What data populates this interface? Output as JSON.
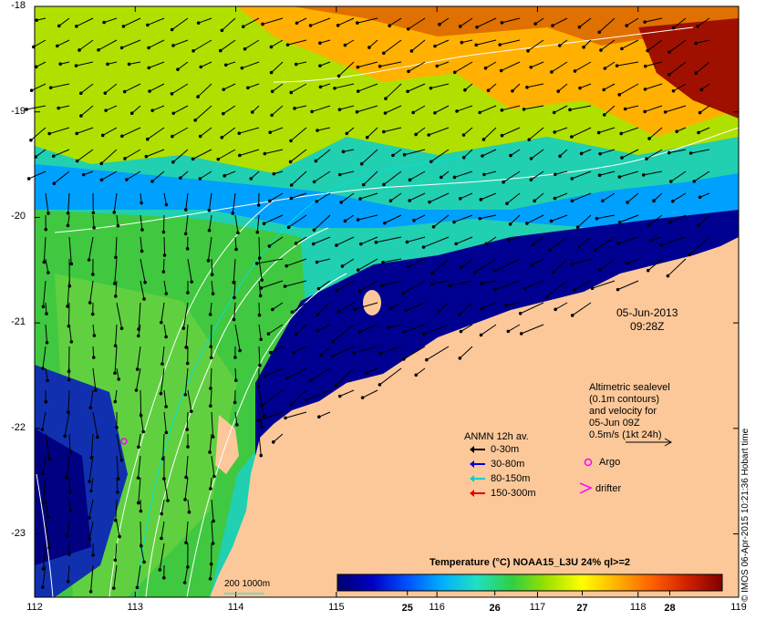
{
  "map": {
    "lat_ticks": [
      "-18",
      "-19",
      "-20",
      "-21",
      "-22",
      "-23"
    ],
    "lon_ticks": [
      "112",
      "113",
      "114",
      "115",
      "116",
      "117",
      "118",
      "119"
    ],
    "lat_range": [
      -23.6,
      -18.0
    ],
    "lon_range": [
      112.0,
      119.0
    ]
  },
  "timestamp": {
    "date": "05-Jun-2013",
    "time": "09:28Z"
  },
  "sealevel_note": {
    "lines": [
      "Altimetric sealevel",
      "(0.1m contours)",
      "and velocity for",
      "05-Jun 09Z",
      "0.5m/s (1kt 24h)"
    ]
  },
  "legend": {
    "title": "ANMN 12h av.",
    "items": [
      {
        "label": "0-30m",
        "color": "#000000"
      },
      {
        "label": "30-80m",
        "color": "#0000e0"
      },
      {
        "label": "80-150m",
        "color": "#00d0d0"
      },
      {
        "label": "150-300m",
        "color": "#e00000"
      }
    ],
    "argo_label": "Argo",
    "drifter_label": "drifter",
    "argo_color": "#ff00ff"
  },
  "colorbar": {
    "title": "Temperature (°C) NOAA15_L3U 24% ql>=2",
    "ticks": [
      "25",
      "26",
      "27",
      "28"
    ],
    "range": [
      24.2,
      28.6
    ],
    "colors": [
      "#000070",
      "#0000c0",
      "#0050ff",
      "#00b0ff",
      "#20e0c0",
      "#30d040",
      "#a0e000",
      "#ffff00",
      "#ffb000",
      "#ff6000",
      "#d02000",
      "#800000"
    ]
  },
  "scale_label": "200  1000m",
  "credit": "© IMOS 06-Apr-2015 10:21:36 Hobart time",
  "colors": {
    "land": "#fcc89a",
    "contour": "#ffffff",
    "iso200": "#00e0e0"
  }
}
